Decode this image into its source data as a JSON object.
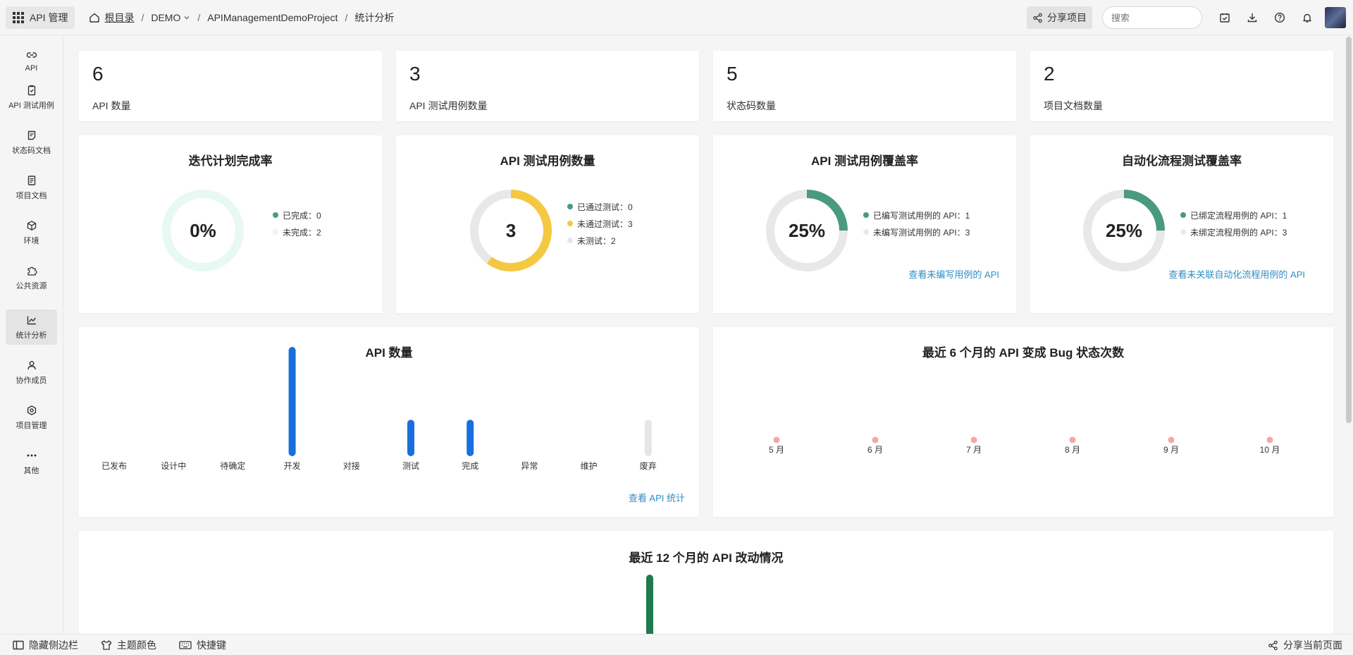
{
  "topbar": {
    "app_label": "API 管理",
    "breadcrumb": {
      "root": "根目录",
      "sep": "/",
      "team": "DEMO",
      "project": "APIManagementDemoProject",
      "page": "统计分析"
    },
    "share_label": "分享项目",
    "search_placeholder": "搜索"
  },
  "sidebar": {
    "items": [
      {
        "label": "API",
        "icon": "link-icon"
      },
      {
        "label": "API 测试用例",
        "icon": "clipboard-check-icon"
      },
      {
        "label": "状态码文档",
        "icon": "doc-icon"
      },
      {
        "label": "项目文档",
        "icon": "file-text-icon"
      },
      {
        "label": "环境",
        "icon": "cube-icon"
      },
      {
        "label": "公共资源",
        "icon": "puzzle-icon"
      },
      {
        "label": "统计分析",
        "icon": "chart-line-icon"
      },
      {
        "label": "协作成员",
        "icon": "users-icon"
      },
      {
        "label": "项目管理",
        "icon": "gear-icon"
      },
      {
        "label": "其他",
        "icon": "more-icon"
      }
    ],
    "active_index": 6
  },
  "stats": [
    {
      "value": "6",
      "label": "API 数量"
    },
    {
      "value": "3",
      "label": "API 测试用例数量"
    },
    {
      "value": "5",
      "label": "状态码数量"
    },
    {
      "value": "2",
      "label": "项目文档数量"
    }
  ],
  "donuts": [
    {
      "title": "迭代计划完成率",
      "center": "0%",
      "legend": [
        {
          "label": "已完成：0",
          "color": "#4a9a7e"
        },
        {
          "label": "未完成：2",
          "color": "#e8f8f3"
        }
      ],
      "segments": [
        {
          "fraction": 0,
          "color": "#4a9a7e"
        },
        {
          "fraction": 1,
          "color": "#e8f8f3"
        }
      ]
    },
    {
      "title": "API 测试用例数量",
      "center": "3",
      "legend": [
        {
          "label": "已通过测试：0",
          "color": "#4a9a7e"
        },
        {
          "label": "未通过测试：3",
          "color": "#f5c842"
        },
        {
          "label": "未测试：2",
          "color": "#e8e8e8"
        }
      ],
      "segments": [
        {
          "fraction": 0,
          "color": "#4a9a7e"
        },
        {
          "fraction": 0.6,
          "color": "#f5c842"
        },
        {
          "fraction": 0.4,
          "color": "#e8e8e8"
        }
      ]
    },
    {
      "title": "API 测试用例覆盖率",
      "center": "25%",
      "legend": [
        {
          "label": "已编写测试用例的 API：1",
          "color": "#4a9a7e"
        },
        {
          "label": "未编写测试用例的 API：3",
          "color": "#e8e8e8"
        }
      ],
      "segments": [
        {
          "fraction": 0.25,
          "color": "#4a9a7e"
        },
        {
          "fraction": 0.75,
          "color": "#e8e8e8"
        }
      ],
      "link": "查看未编写用例的 API"
    },
    {
      "title": "自动化流程测试覆盖率",
      "center": "25%",
      "legend": [
        {
          "label": "已绑定流程用例的 API：1",
          "color": "#4a9a7e"
        },
        {
          "label": "未绑定流程用例的 API：3",
          "color": "#e8e8e8"
        }
      ],
      "segments": [
        {
          "fraction": 0.25,
          "color": "#4a9a7e"
        },
        {
          "fraction": 0.75,
          "color": "#e8e8e8"
        }
      ],
      "link": "查看未关联自动化流程用例的 API"
    }
  ],
  "api_chart": {
    "title": "API 数量",
    "link": "查看 API 统计"
  },
  "bug_chart": {
    "title": "最近 6 个月的 API 变成 Bug 状态次数"
  },
  "changes_chart": {
    "title": "最近 12 个月的 API 改动情况"
  },
  "chart_data": [
    {
      "type": "bar",
      "categories": [
        "已发布",
        "设计中",
        "待确定",
        "开发",
        "对接",
        "测试",
        "完成",
        "异常",
        "维护",
        "废弃"
      ],
      "values": [
        0,
        0,
        0,
        3,
        0,
        1,
        1,
        0,
        0,
        1
      ],
      "colors": [
        "#1a6fde",
        "#1a6fde",
        "#1a6fde",
        "#1a6fde",
        "#1a6fde",
        "#1a6fde",
        "#1a6fde",
        "#1a6fde",
        "#1a6fde",
        "#e6e6e6"
      ],
      "ylim": [
        0,
        3
      ]
    },
    {
      "type": "scatter",
      "categories": [
        "5 月",
        "6 月",
        "7 月",
        "8 月",
        "9 月",
        "10 月"
      ],
      "values": [
        0,
        0,
        0,
        0,
        0,
        0
      ],
      "color": "#f4a7a7"
    }
  ],
  "bottombar": {
    "hide_sidebar": "隐藏侧边栏",
    "theme": "主题颜色",
    "shortcuts": "快捷键",
    "share_page": "分享当前页面"
  }
}
